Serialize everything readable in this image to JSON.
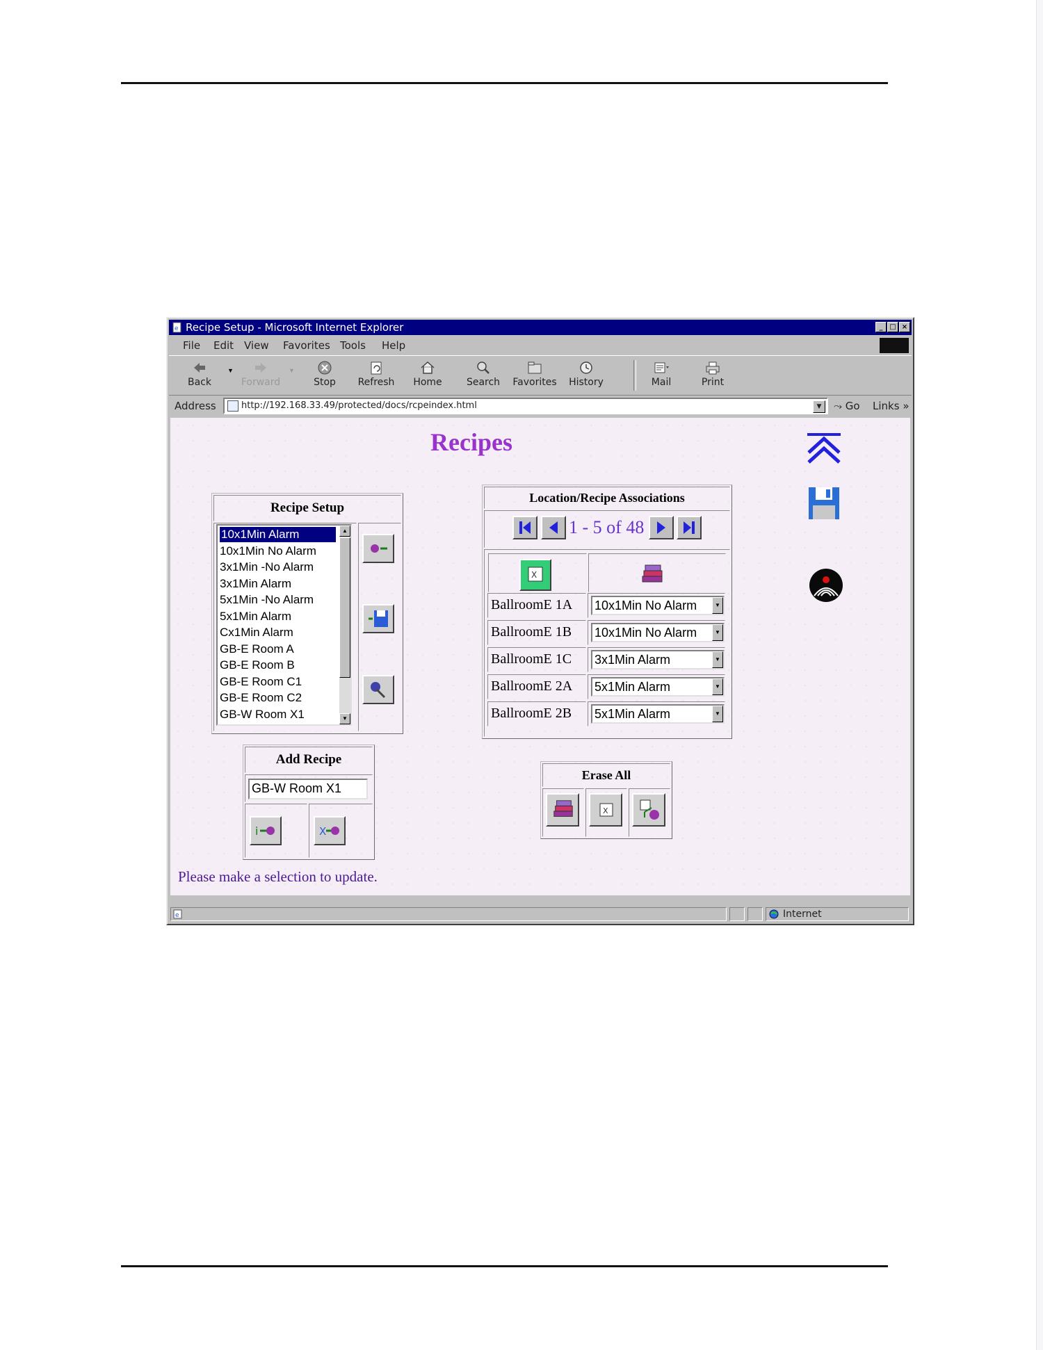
{
  "browser": {
    "title": "Recipe Setup - Microsoft Internet Explorer",
    "menu": [
      "File",
      "Edit",
      "View",
      "Favorites",
      "Tools",
      "Help"
    ],
    "toolbar": {
      "back": "Back",
      "forward": "Forward",
      "stop": "Stop",
      "refresh": "Refresh",
      "home": "Home",
      "search": "Search",
      "favorites": "Favorites",
      "history": "History",
      "mail": "Mail",
      "print": "Print"
    },
    "address_label": "Address",
    "url": "http://192.168.33.49/protected/docs/rcpeindex.html",
    "go_label": "Go",
    "links_label": "Links",
    "status_zone": "Internet"
  },
  "page": {
    "title": "Recipes",
    "message": "Please make a selection to update."
  },
  "recipe_setup": {
    "heading": "Recipe Setup",
    "items": [
      "10x1Min Alarm",
      "10x1Min No Alarm",
      "3x1Min -No Alarm",
      "3x1Min Alarm",
      "5x1Min -No Alarm",
      "5x1Min Alarm",
      "Cx1Min Alarm",
      "GB-E Room A",
      "GB-E Room B",
      "GB-E Room C1",
      "GB-E Room C2",
      "GB-W Room X1"
    ],
    "selected_index": 0
  },
  "add_recipe": {
    "heading": "Add Recipe",
    "value": "GB-W Room X1"
  },
  "associations": {
    "heading": "Location/Recipe Associations",
    "page_count": "1 - 5 of 48",
    "rows": [
      {
        "location": "BallroomE 1A",
        "recipe": "10x1Min No Alarm"
      },
      {
        "location": "BallroomE 1B",
        "recipe": "10x1Min No Alarm"
      },
      {
        "location": "BallroomE 1C",
        "recipe": "3x1Min Alarm"
      },
      {
        "location": "BallroomE 2A",
        "recipe": "5x1Min Alarm"
      },
      {
        "location": "BallroomE 2B",
        "recipe": "5x1Min Alarm"
      }
    ]
  },
  "erase_all": {
    "heading": "Erase All"
  },
  "colors": {
    "title_purple": "#9933cc",
    "nav_blue": "#2222dd",
    "selection_navy": "#000080",
    "page_bg": "#f6eef7",
    "message_purple": "#4b1a91"
  }
}
